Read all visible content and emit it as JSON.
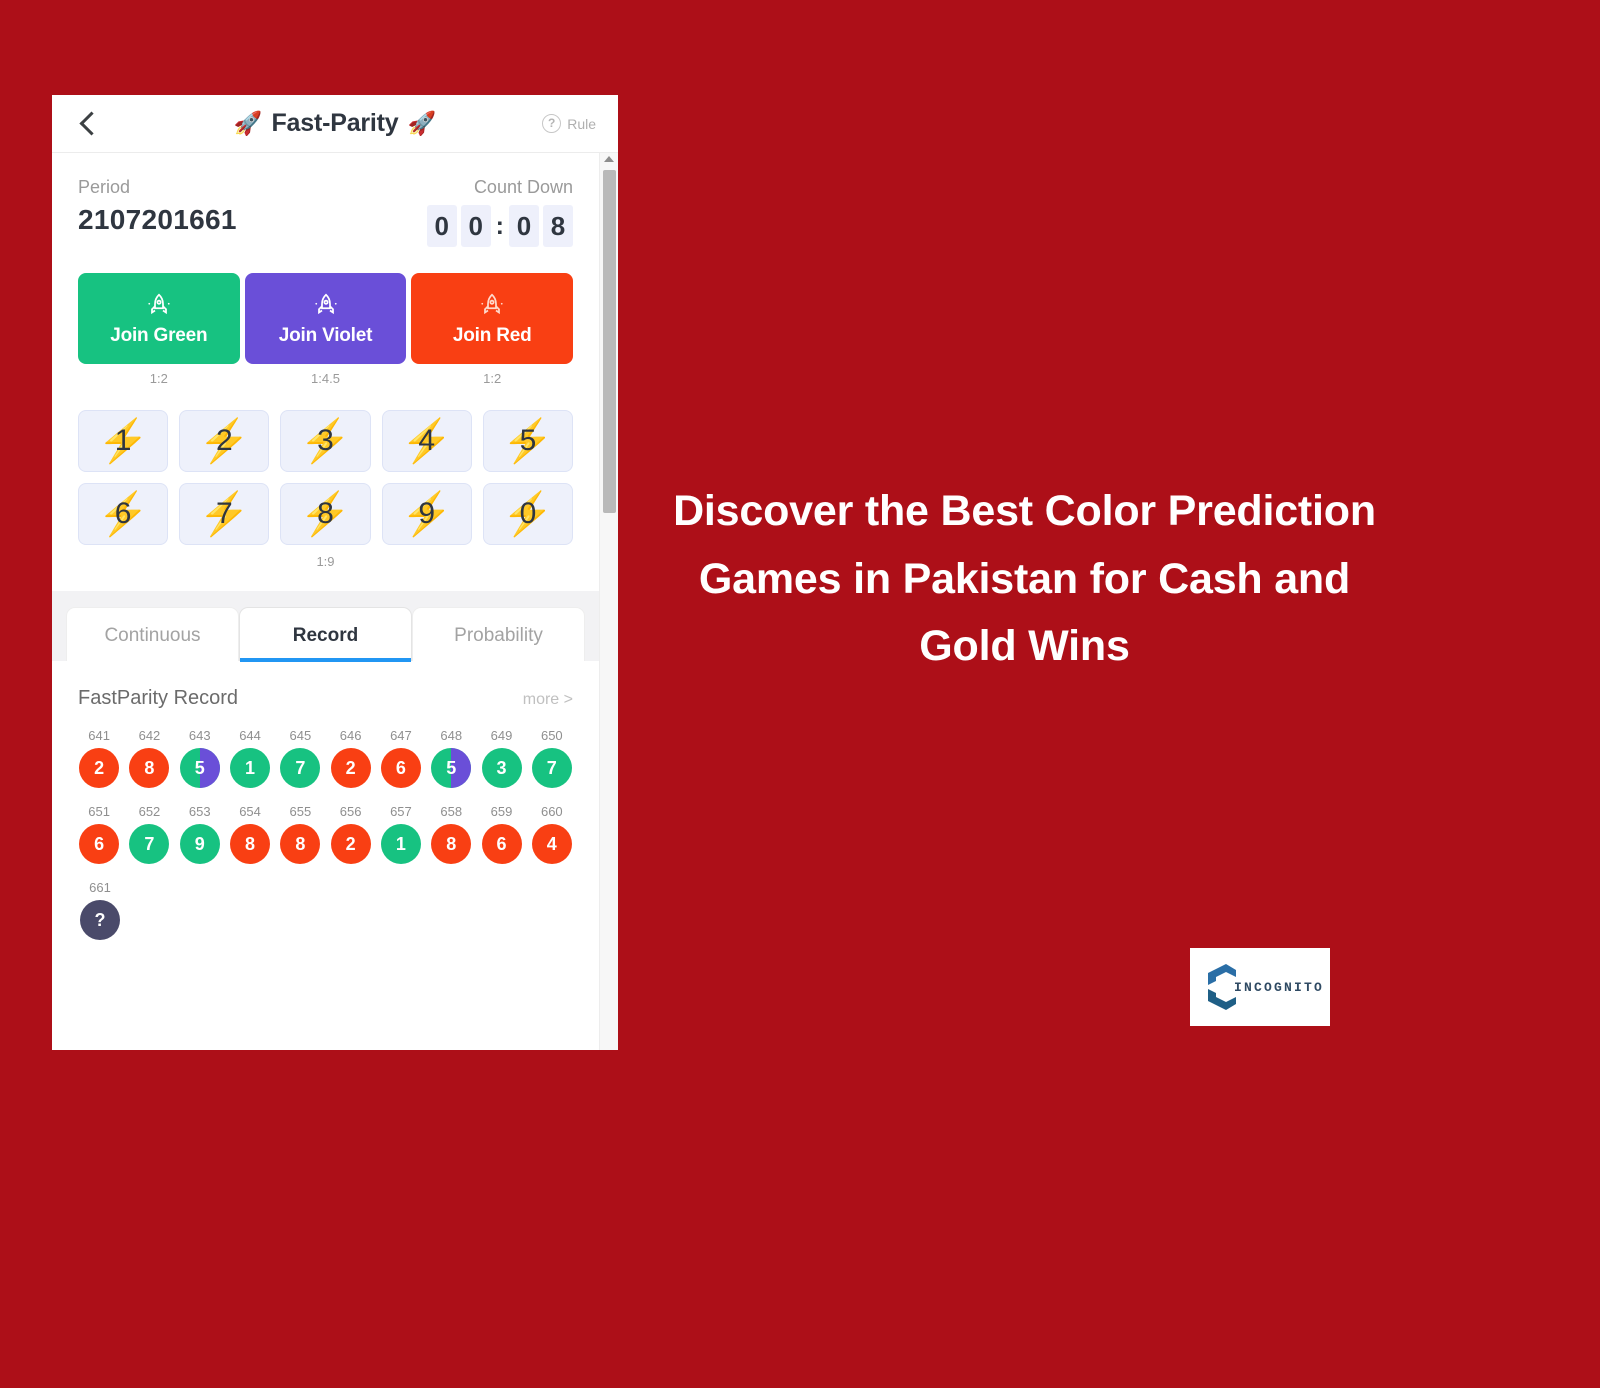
{
  "page": {
    "background_color": "#AD0F18",
    "headline": "Discover the Best Color Prediction Games in Pakistan for Cash and Gold Wins"
  },
  "app": {
    "header": {
      "back_icon": "chevron-left-icon",
      "title": "Fast-Parity",
      "rocket_left": "🚀",
      "rocket_right": "🚀",
      "rule_label": "Rule",
      "rule_icon": "question-circle-icon"
    },
    "period": {
      "label": "Period",
      "value": "2107201661"
    },
    "countdown": {
      "label": "Count Down",
      "d1": "0",
      "d2": "0",
      "separator": ":",
      "d3": "0",
      "d4": "8"
    },
    "join_buttons": [
      {
        "label": "Join Green",
        "odds": "1:2",
        "color": "#17c281",
        "icon": "rocket-outline-icon"
      },
      {
        "label": "Join Violet",
        "odds": "1:4.5",
        "color": "#6a4fd8",
        "icon": "rocket-outline-icon"
      },
      {
        "label": "Join Red",
        "odds": "1:2",
        "color": "#f93f13",
        "icon": "rocket-outline-icon"
      }
    ],
    "number_grid": {
      "row1": [
        "1",
        "2",
        "3",
        "4",
        "5"
      ],
      "row2": [
        "6",
        "7",
        "8",
        "9",
        "0"
      ],
      "odds": "1:9",
      "watermark_icon": "lightning-bolt-icon"
    },
    "tabs": [
      {
        "label": "Continuous",
        "active": false
      },
      {
        "label": "Record",
        "active": true
      },
      {
        "label": "Probability",
        "active": false
      }
    ],
    "record": {
      "title": "FastParity Record",
      "more_label": "more >",
      "rows": [
        [
          {
            "period": "641",
            "number": "2",
            "color": "red"
          },
          {
            "period": "642",
            "number": "8",
            "color": "red"
          },
          {
            "period": "643",
            "number": "5",
            "color": "split"
          },
          {
            "period": "644",
            "number": "1",
            "color": "green"
          },
          {
            "period": "645",
            "number": "7",
            "color": "green"
          },
          {
            "period": "646",
            "number": "2",
            "color": "red"
          },
          {
            "period": "647",
            "number": "6",
            "color": "red"
          },
          {
            "period": "648",
            "number": "5",
            "color": "split"
          },
          {
            "period": "649",
            "number": "3",
            "color": "green"
          },
          {
            "period": "650",
            "number": "7",
            "color": "green"
          }
        ],
        [
          {
            "period": "651",
            "number": "6",
            "color": "red"
          },
          {
            "period": "652",
            "number": "7",
            "color": "green"
          },
          {
            "period": "653",
            "number": "9",
            "color": "green"
          },
          {
            "period": "654",
            "number": "8",
            "color": "red"
          },
          {
            "period": "655",
            "number": "8",
            "color": "red"
          },
          {
            "period": "656",
            "number": "2",
            "color": "red"
          },
          {
            "period": "657",
            "number": "1",
            "color": "green"
          },
          {
            "period": "658",
            "number": "8",
            "color": "red"
          },
          {
            "period": "659",
            "number": "6",
            "color": "red"
          },
          {
            "period": "660",
            "number": "4",
            "color": "red"
          }
        ],
        [
          {
            "period": "661",
            "number": "?",
            "color": "unknown"
          }
        ]
      ]
    },
    "scrollbar": {
      "up_arrow_icon": "triangle-up-icon"
    }
  },
  "logo": {
    "word": "INCOGNITO",
    "mark_icon": "hexagon-c-logo-icon",
    "mark_color": "#2a6ea6"
  }
}
